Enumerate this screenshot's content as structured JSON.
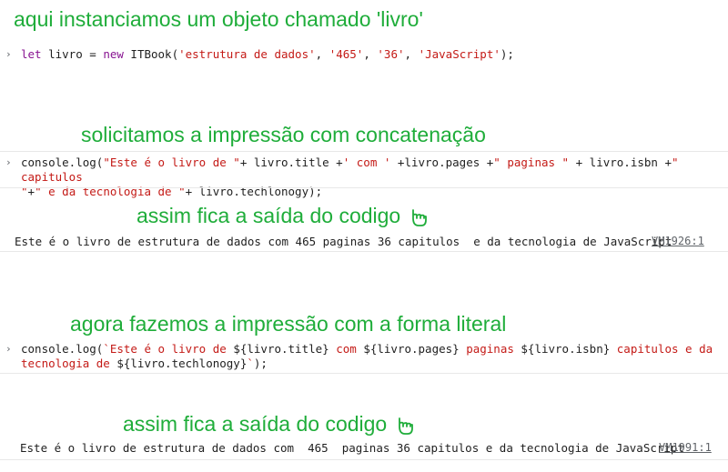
{
  "annotations": {
    "a1": "aqui instanciamos um objeto chamado 'livro'",
    "a2": "solicitamos a impressão com concatenação",
    "a3": "assim fica a saída do codigo",
    "a4": "agora fazemos a impressão com a forma literal",
    "a5": "assim fica a saída do codigo"
  },
  "console": {
    "prompt": "›",
    "cmd1": {
      "kw_let": "let",
      "ident": " livro = ",
      "kw_new": "new",
      "call": " ITBook(",
      "s1": "'estrutura de dados'",
      "s2": "'465'",
      "s3": "'36'",
      "s4": "'JavaScript'",
      "end": ");"
    },
    "cmd2": {
      "l1_a": "console.log(",
      "l1_s1": "\"Este é o livro de \"",
      "l1_b": "+ livro.title +",
      "l1_s2": "' com '",
      "l1_c": " +livro.pages +",
      "l1_s3": "\" paginas \"",
      "l1_d": " + livro.isbn +",
      "l1_s4": "\" capitulos",
      "l2_s4": "\"",
      "l2_a": "+",
      "l2_s5": "\" e da tecnologia de \"",
      "l2_b": "+ livro.techlonogy);"
    },
    "out1": {
      "text": "Este é o livro de estrutura de dados com 465 paginas 36 capitulos  e da tecnologia de JavaScript",
      "source": "VM1926:1"
    },
    "cmd3": {
      "l1_a": "console.log(",
      "l1_s1": "`Este é o livro de ",
      "l1_e1": "${livro.title}",
      "l1_s2": " com  ",
      "l1_e2": "${livro.pages}",
      "l1_s3": "  paginas ",
      "l1_e3": "${livro.isbn}",
      "l1_s4": " capitulos e da",
      "l2_s1": "tecnologia de ",
      "l2_e1": "${livro.techlonogy}",
      "l2_s2": "`",
      "l2_end": ");"
    },
    "out2": {
      "text": "Este é o livro de estrutura de dados com  465  paginas 36 capitulos e da tecnologia de JavaScript",
      "source": "VM1991:1"
    }
  },
  "colors": {
    "annotation": "#1fad3a",
    "keyword": "#881391",
    "string": "#c41a16",
    "link": "#5f6368"
  }
}
